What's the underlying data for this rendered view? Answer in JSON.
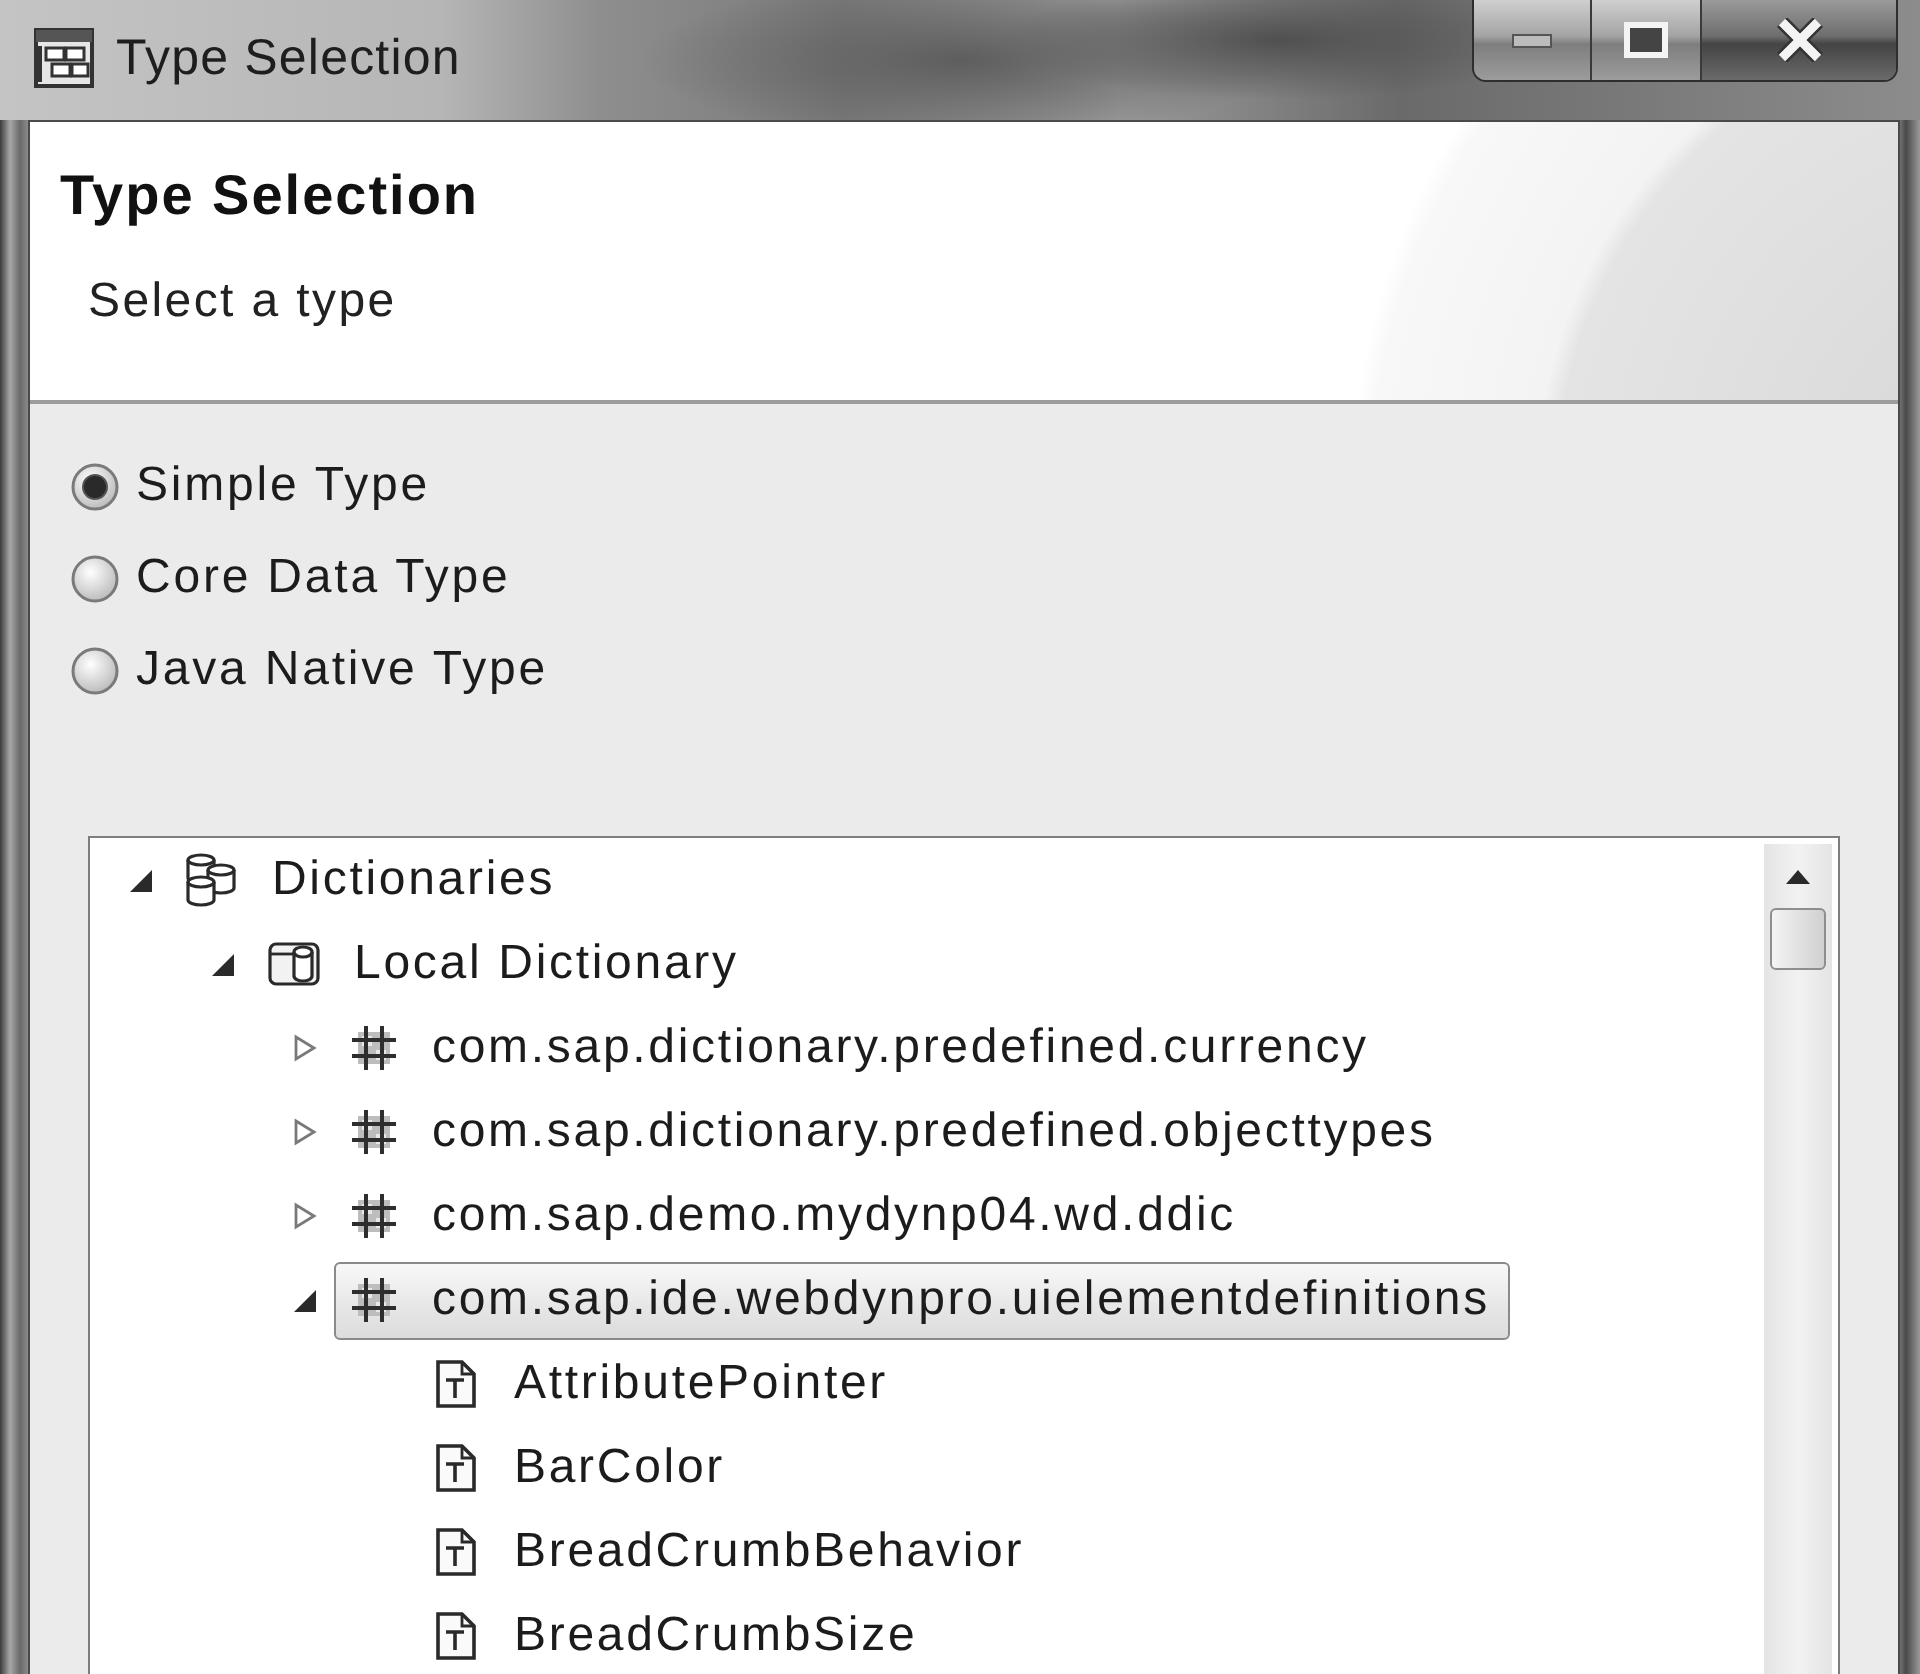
{
  "window": {
    "title": "Type Selection"
  },
  "header": {
    "title": "Type Selection",
    "subtitle": "Select a type"
  },
  "type_options": [
    {
      "label": "Simple Type",
      "selected": true
    },
    {
      "label": "Core Data Type",
      "selected": false
    },
    {
      "label": "Java Native Type",
      "selected": false
    }
  ],
  "tree": [
    {
      "label": "Dictionaries",
      "kind": "dictionaries",
      "expanded": true,
      "selected": false,
      "children": [
        {
          "label": "Local Dictionary",
          "kind": "dictionary",
          "expanded": true,
          "selected": false,
          "children": [
            {
              "label": "com.sap.dictionary.predefined.currency",
              "kind": "package",
              "expanded": false,
              "selected": false
            },
            {
              "label": "com.sap.dictionary.predefined.objecttypes",
              "kind": "package",
              "expanded": false,
              "selected": false
            },
            {
              "label": "com.sap.demo.mydynp04.wd.ddic",
              "kind": "package",
              "expanded": false,
              "selected": false
            },
            {
              "label": "com.sap.ide.webdynpro.uielementdefinitions",
              "kind": "package",
              "expanded": true,
              "selected": true,
              "children": [
                {
                  "label": "AttributePointer",
                  "kind": "type",
                  "selected": false
                },
                {
                  "label": "BarColor",
                  "kind": "type",
                  "selected": false
                },
                {
                  "label": "BreadCrumbBehavior",
                  "kind": "type",
                  "selected": false
                },
                {
                  "label": "BreadCrumbSize",
                  "kind": "type",
                  "selected": false
                }
              ]
            }
          ]
        }
      ]
    }
  ]
}
